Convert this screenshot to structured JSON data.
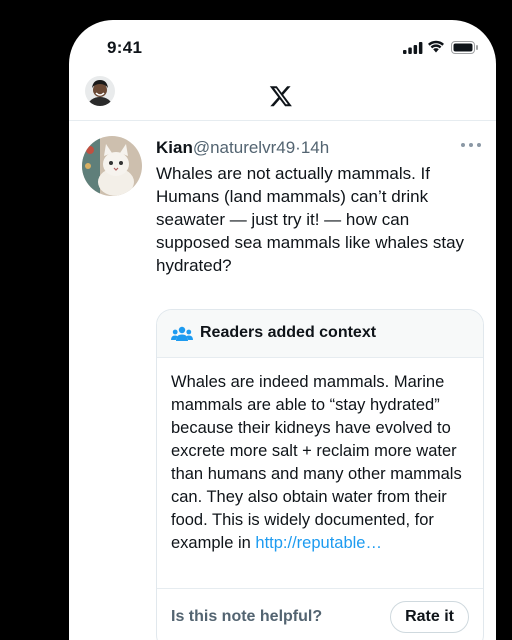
{
  "status_bar": {
    "time": "9:41"
  },
  "nav": {
    "logo": "x-logo-icon"
  },
  "tweet": {
    "display_name": "Kian",
    "handle": "@naturelvr49",
    "separator": "·",
    "time": "14h",
    "text": "Whales are not actually mammals. If Humans (land mammals) can’t drink seawater — just try it! — how can supposed sea mammals like whales stay hydrated?"
  },
  "note": {
    "title": "Readers added context",
    "body": "Whales are indeed mammals. Marine mammals are able to “stay hydrated” because their kidneys have evolved to excrete more salt + reclaim more water than humans and many other mammals can. They also obtain water from their food. This is widely documented, for example in ",
    "link": "http://reputable…",
    "helpful_prompt": "Is this note helpful?",
    "rate_label": "Rate it"
  },
  "colors": {
    "link": "#1d9bf0",
    "text": "#0f1419",
    "muted": "#536471"
  }
}
